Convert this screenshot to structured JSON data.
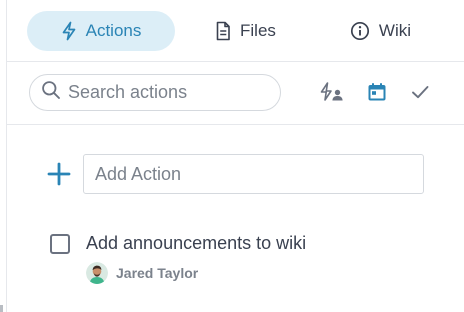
{
  "tabs": [
    {
      "label": "Actions",
      "icon": "lightning-icon",
      "active": true
    },
    {
      "label": "Files",
      "icon": "document-icon",
      "active": false
    },
    {
      "label": "Wiki",
      "icon": "info-circle-icon",
      "active": false
    }
  ],
  "search": {
    "placeholder": "Search actions"
  },
  "filters": [
    {
      "icon": "assigned-to-me-icon"
    },
    {
      "icon": "calendar-icon"
    },
    {
      "icon": "checkmark-icon"
    }
  ],
  "add_action": {
    "placeholder": "Add Action",
    "icon": "plus-icon"
  },
  "actions": [
    {
      "title": "Add announcements to wiki",
      "assignee": "Jared Taylor",
      "completed": false
    }
  ],
  "colors": {
    "accent": "#2a84b5",
    "active_tab_bg": "#dceef7",
    "text": "#3a4150",
    "muted": "#7b828c"
  }
}
